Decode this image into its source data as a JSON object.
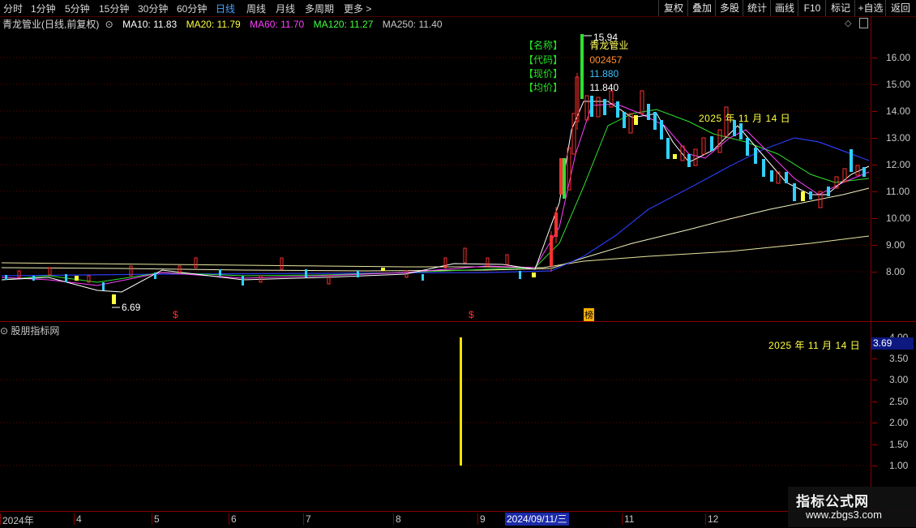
{
  "toolbar": {
    "left": [
      "分时",
      "1分钟",
      "5分钟",
      "15分钟",
      "30分钟",
      "60分钟",
      "日线",
      "周线",
      "月线",
      "多周期",
      "更多 >"
    ],
    "right": [
      "复权",
      "叠加",
      "多股",
      "统计",
      "画线",
      "F10",
      "标记",
      "+自选",
      "返回"
    ]
  },
  "info": {
    "title": "青龙管业(日线,前复权)",
    "ma10": "MA10: 11.83",
    "ma20": "MA20: 11.79",
    "ma60": "MA60: 11.70",
    "ma120": "MA120: 11.27",
    "ma250": "MA250: 11.40"
  },
  "colors": {
    "ma10": "#ffffff",
    "ma20": "#ffff40",
    "ma60": "#ff40ff",
    "ma120": "#40ff40",
    "ma250": "#c8c8c8",
    "up": "#ff3030",
    "down": "#30d0ff",
    "grid": "#8a0000",
    "accent": "#1a2aa8"
  },
  "price_axis": [
    "16.00",
    "15.00",
    "14.00",
    "13.00",
    "12.00",
    "11.00",
    "10.00",
    "9.00",
    "8.00"
  ],
  "stock_box": {
    "name_key": "【名称】",
    "name_val": "青龙管业",
    "code_key": "【代码】",
    "code_val": "002457",
    "price_key": "【现价】",
    "price_val": "11.880",
    "avg_key": "【均价】",
    "avg_val": "11.840"
  },
  "annotations": {
    "high": "15.94",
    "low": "6.69",
    "chart_date": "2025 年 11 月 14 日",
    "mark1": "$",
    "mark2": "$",
    "mark3": "榜"
  },
  "indicator": {
    "title": "股朋指标网",
    "date": "2025 年 11 月 14 日",
    "value": "3.69",
    "axis": [
      "4.00",
      "3.50",
      "3.00",
      "2.50",
      "2.00",
      "1.50",
      "1.00"
    ]
  },
  "time_axis": {
    "labels": [
      "2024年",
      "4",
      "5",
      "6",
      "7",
      "8",
      "9",
      "11",
      "12"
    ],
    "cursor": "2024/09/11/三"
  },
  "watermark": {
    "line1": "指标公式网",
    "line2": "www.zbgs3.com"
  }
}
